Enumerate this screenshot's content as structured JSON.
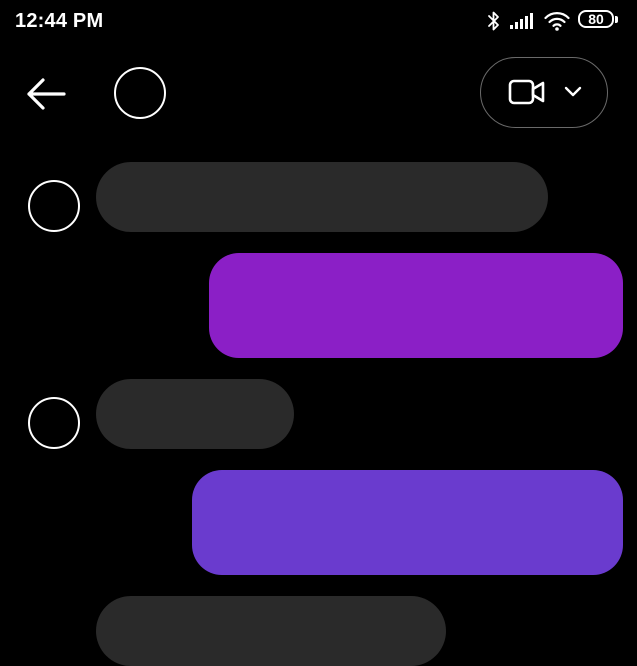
{
  "status_bar": {
    "time": "12:44 PM",
    "battery_level": "80",
    "icons": [
      "bluetooth-icon",
      "signal-icon",
      "wifi-icon",
      "battery-icon"
    ]
  },
  "header": {
    "icons": [
      "back-arrow-icon",
      "video-camera-icon",
      "chevron-down-icon"
    ]
  },
  "messages": [
    {
      "direction": "incoming",
      "text": ""
    },
    {
      "direction": "outgoing",
      "text": ""
    },
    {
      "direction": "incoming",
      "text": ""
    },
    {
      "direction": "outgoing",
      "text": ""
    },
    {
      "direction": "incoming",
      "text": ""
    }
  ],
  "colors": {
    "background": "#000000",
    "incoming_bubble": "#2a2a2a",
    "outgoing_bubble_purple": "#8b1fc6",
    "outgoing_bubble_violet": "#6a3bce",
    "call_button_border": "#6a6a6a"
  }
}
